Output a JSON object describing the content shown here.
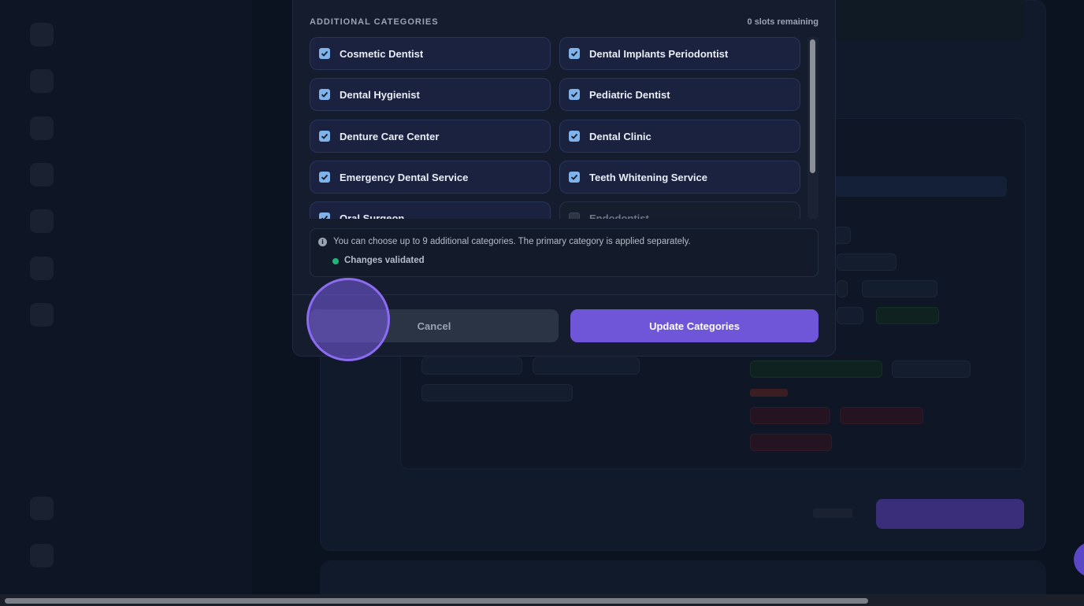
{
  "modal": {
    "section_title": "ADDITIONAL CATEGORIES",
    "slots_remaining": "0 slots remaining",
    "categories": [
      {
        "label": "Cosmetic Dentist",
        "checked": true
      },
      {
        "label": "Dental Implants Periodontist",
        "checked": true
      },
      {
        "label": "Dental Hygienist",
        "checked": true
      },
      {
        "label": "Pediatric Dentist",
        "checked": true
      },
      {
        "label": "Denture Care Center",
        "checked": true
      },
      {
        "label": "Dental Clinic",
        "checked": true
      },
      {
        "label": "Emergency Dental Service",
        "checked": true
      },
      {
        "label": "Teeth Whitening Service",
        "checked": true
      },
      {
        "label": "Oral Surgeon",
        "checked": true
      },
      {
        "label": "Endodontist",
        "checked": false
      }
    ],
    "info_text": "You can choose up to 9 additional categories. The primary category is applied separately.",
    "validation_text": "Changes validated",
    "cancel_label": "Cancel",
    "update_label": "Update Categories"
  },
  "colors": {
    "accent": "#6f55d8",
    "checkbox": "#7fb3ea",
    "validated": "#22b47a",
    "background": "#0b1220"
  }
}
